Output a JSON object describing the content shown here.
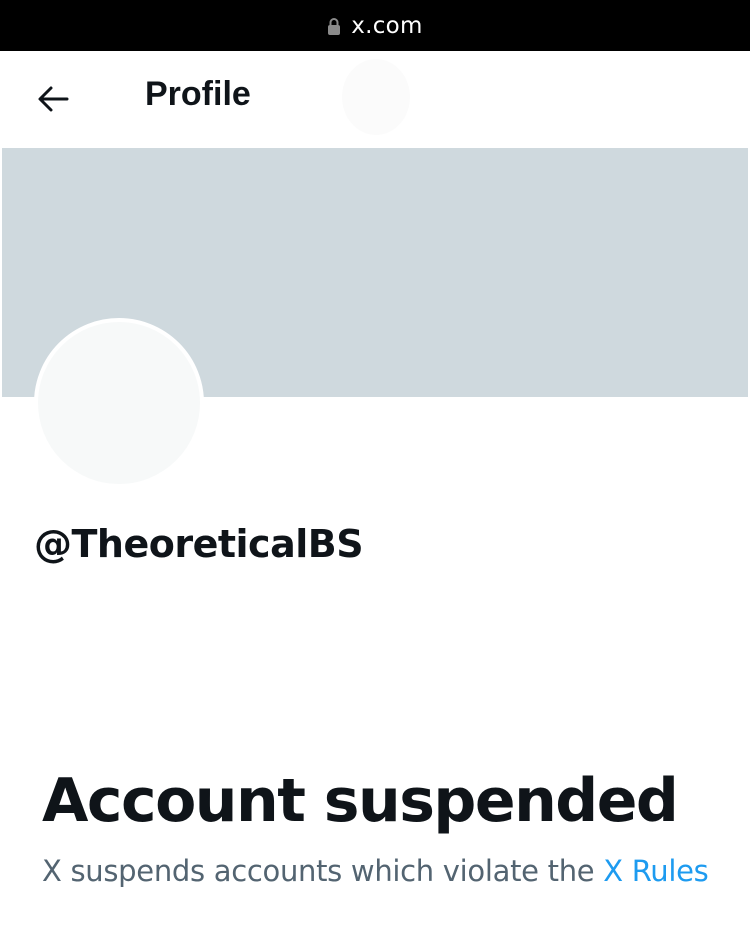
{
  "browser": {
    "url": "x.com",
    "lock_icon": "lock-icon"
  },
  "header": {
    "back_icon": "arrow-left-icon",
    "title": "Profile"
  },
  "profile": {
    "banner_color": "#cfd9de",
    "avatar_color": "#f7f9f9",
    "handle": "@TheoreticalBS"
  },
  "notice": {
    "title": "Account suspended",
    "description": "X suspends accounts which violate the ",
    "link_text": "X Rules",
    "link_color": "#1d9bf0"
  }
}
